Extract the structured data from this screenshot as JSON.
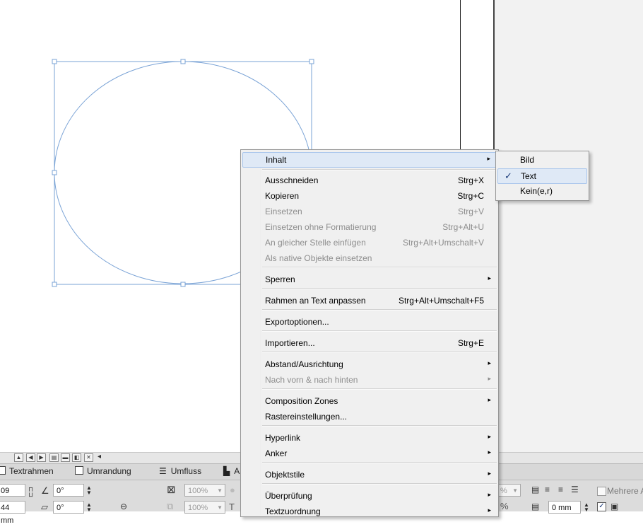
{
  "canvas": {},
  "control_panel": {
    "tabs": [
      "Textrahmen",
      "Umrandung",
      "Umfluss",
      "A"
    ],
    "x_value": "09 mm",
    "y_value": "44 mm",
    "angle_value": "0°",
    "shear_value": "0°",
    "scale_x": "100%",
    "scale_y": "100%",
    "percent_right": "%",
    "right_mm": "0 mm",
    "mehrere_label": "Mehrere A"
  },
  "context_menu": {
    "items": [
      {
        "label": "Inhalt",
        "shortcut": "",
        "submenu": true,
        "disabled": false,
        "highlighted": true
      },
      {
        "label": "Ausschneiden",
        "shortcut": "Strg+X",
        "submenu": false,
        "disabled": false
      },
      {
        "label": "Kopieren",
        "shortcut": "Strg+C",
        "submenu": false,
        "disabled": false
      },
      {
        "label": "Einsetzen",
        "shortcut": "Strg+V",
        "submenu": false,
        "disabled": true
      },
      {
        "label": "Einsetzen ohne Formatierung",
        "shortcut": "Strg+Alt+U",
        "submenu": false,
        "disabled": true
      },
      {
        "label": "An gleicher Stelle einfügen",
        "shortcut": "Strg+Alt+Umschalt+V",
        "submenu": false,
        "disabled": true
      },
      {
        "label": "Als native Objekte einsetzen",
        "shortcut": "",
        "submenu": false,
        "disabled": true
      },
      {
        "label": "Sperren",
        "shortcut": "",
        "submenu": true,
        "disabled": false
      },
      {
        "label": "Rahmen an Text anpassen",
        "shortcut": "Strg+Alt+Umschalt+F5",
        "submenu": false,
        "disabled": false
      },
      {
        "label": "Exportoptionen...",
        "shortcut": "",
        "submenu": false,
        "disabled": false
      },
      {
        "label": "Importieren...",
        "shortcut": "Strg+E",
        "submenu": false,
        "disabled": false
      },
      {
        "label": "Abstand/Ausrichtung",
        "shortcut": "",
        "submenu": true,
        "disabled": false
      },
      {
        "label": "Nach vorn & nach hinten",
        "shortcut": "",
        "submenu": true,
        "disabled": true
      },
      {
        "label": "Composition Zones",
        "shortcut": "",
        "submenu": true,
        "disabled": false
      },
      {
        "label": "Rastereinstellungen...",
        "shortcut": "",
        "submenu": false,
        "disabled": false
      },
      {
        "label": "Hyperlink",
        "shortcut": "",
        "submenu": true,
        "disabled": false
      },
      {
        "label": "Anker",
        "shortcut": "",
        "submenu": true,
        "disabled": false
      },
      {
        "label": "Objektstile",
        "shortcut": "",
        "submenu": true,
        "disabled": false
      },
      {
        "label": "Überprüfung",
        "shortcut": "",
        "submenu": true,
        "disabled": false
      },
      {
        "label": "Textzuordnung",
        "shortcut": "",
        "submenu": true,
        "disabled": false
      }
    ]
  },
  "submenu": {
    "items": [
      {
        "label": "Bild",
        "checked": false
      },
      {
        "label": "Text",
        "checked": true,
        "highlighted": true
      },
      {
        "label": "Kein(e,r)",
        "checked": false
      }
    ],
    "check_glyph": "✓"
  },
  "icons": {
    "submenu_arrow": "▸",
    "spinner": "▲▼"
  },
  "colors": {
    "selection": "#7aa3d6",
    "menu_bg": "#f0f0f0",
    "highlight": "#dfe9f6",
    "disabled_text": "#8d8d8d"
  }
}
